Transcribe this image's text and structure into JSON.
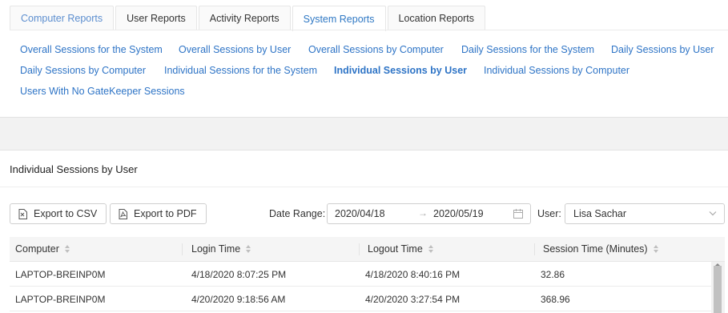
{
  "tabs": [
    {
      "label": "Computer Reports"
    },
    {
      "label": "User Reports"
    },
    {
      "label": "Activity Reports"
    },
    {
      "label": "System Reports",
      "active": true
    },
    {
      "label": "Location Reports"
    }
  ],
  "report_links": [
    {
      "label": "Overall Sessions for the System"
    },
    {
      "label": "Overall Sessions by User"
    },
    {
      "label": "Overall Sessions by Computer"
    },
    {
      "label": "Daily Sessions for the System"
    },
    {
      "label": "Daily Sessions by User"
    },
    {
      "label": "Daily Sessions by Computer"
    },
    {
      "label": "Individual Sessions for the System"
    },
    {
      "label": "Individual Sessions by User",
      "active": true
    },
    {
      "label": "Individual Sessions by Computer"
    },
    {
      "label": "Users With No GateKeeper Sessions"
    }
  ],
  "section": {
    "title": "Individual Sessions by User"
  },
  "toolbar": {
    "export_csv": "Export to CSV",
    "export_pdf": "Export to PDF",
    "date_range_label": "Date Range:",
    "date_start": "2020/04/18",
    "date_end": "2020/05/19",
    "user_label": "User:",
    "user_value": "Lisa Sachar"
  },
  "table": {
    "columns": [
      "Computer",
      "Login Time",
      "Logout Time",
      "Session Time (Minutes)"
    ],
    "rows": [
      [
        "LAPTOP-BREINP0M",
        "4/18/2020 8:07:25 PM",
        "4/18/2020 8:40:16 PM",
        "32.86"
      ],
      [
        "LAPTOP-BREINP0M",
        "4/20/2020 9:18:56 AM",
        "4/20/2020 3:27:54 PM",
        "368.96"
      ]
    ]
  },
  "colors": {
    "accent": "#2e74c6",
    "band": "#f2f2f2",
    "header": "#f5f5f5"
  }
}
